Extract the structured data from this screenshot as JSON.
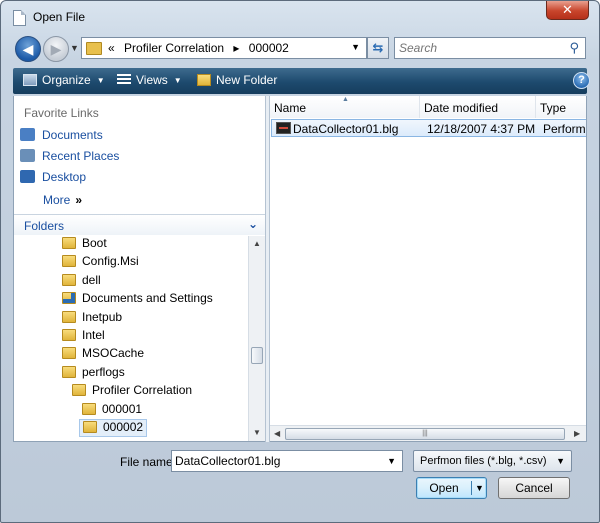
{
  "window": {
    "title": "Open File",
    "close_glyph": "✕"
  },
  "nav": {
    "back_glyph": "◀",
    "forward_glyph": "▶",
    "history_glyph": "▼",
    "breadcrumb": [
      "«",
      "Profiler Correlation",
      "▸",
      "000002"
    ],
    "address_drop": "▼",
    "refresh_glyph": "⇆",
    "search_placeholder": "Search",
    "search_icon": "⚲"
  },
  "toolbar": {
    "organize_label": "Organize",
    "views_label": "Views",
    "new_folder_label": "New Folder",
    "help_label": "?",
    "caret": "▼"
  },
  "favorites": {
    "title": "Favorite Links",
    "items": [
      {
        "label": "Documents",
        "icon": "documents-icon",
        "color": "#4a7fc4"
      },
      {
        "label": "Recent Places",
        "icon": "recent-places-icon",
        "color": "#6a8fb8"
      },
      {
        "label": "Desktop",
        "icon": "desktop-icon",
        "color": "#2f68b0"
      }
    ],
    "more_label": "More",
    "more_glyph": "»"
  },
  "folders": {
    "label": "Folders",
    "collapse_glyph": "⌄",
    "tree": [
      {
        "label": "Boot"
      },
      {
        "label": "Config.Msi"
      },
      {
        "label": "dell"
      },
      {
        "label": "Documents and Settings"
      },
      {
        "label": "Inetpub"
      },
      {
        "label": "Intel"
      },
      {
        "label": "MSOCache"
      },
      {
        "label": "perflogs"
      },
      {
        "label": "Profiler Correlation"
      },
      {
        "label": "000001"
      },
      {
        "label": "000002"
      }
    ],
    "scroll_up": "▲",
    "scroll_down": "▼"
  },
  "file_list": {
    "columns": [
      "Name",
      "Date modified",
      "Type"
    ],
    "sort_glyph": "▲",
    "rows": [
      {
        "name": "DataCollector01.blg",
        "date": "12/18/2007 4:37 PM",
        "type": "Performa"
      }
    ],
    "scroll_left": "◀",
    "scroll_right": "▶",
    "thumb_grip": "|||"
  },
  "footer": {
    "file_name_label": "File name:",
    "file_name_value": "DataCollector01.blg",
    "file_name_drop": "▼",
    "file_type_value": "Perfmon files (*.blg, *.csv)",
    "file_type_drop": "▼",
    "open_label": "Open",
    "open_drop": "▼",
    "cancel_label": "Cancel"
  }
}
